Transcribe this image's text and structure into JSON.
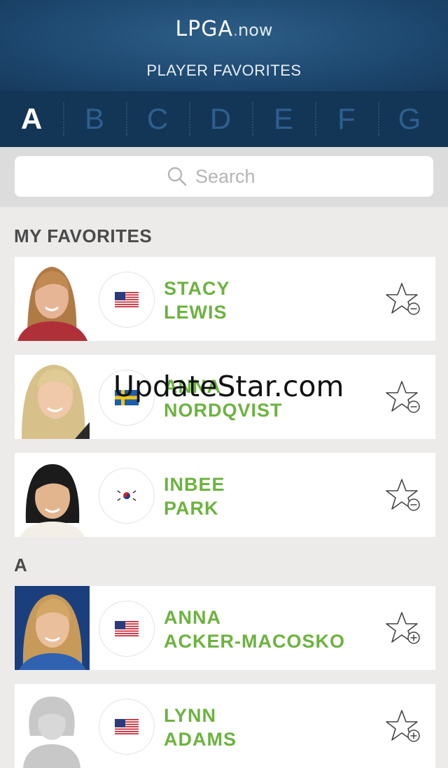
{
  "header": {
    "logo_main": "LPGA",
    "logo_dot": ".",
    "logo_sub": "now",
    "title": "PLAYER FAVORITES"
  },
  "alphabet": [
    "A",
    "B",
    "C",
    "D",
    "E",
    "F",
    "G"
  ],
  "alphabet_active": "A",
  "search": {
    "placeholder": "Search"
  },
  "sections": {
    "favorites_title": "MY FAVORITES",
    "a_title": "A"
  },
  "favorites": [
    {
      "first": "STACY",
      "last": "LEWIS",
      "flag": "usa",
      "action": "remove"
    },
    {
      "first": "ANNA",
      "last": "NORDQVIST",
      "flag": "sweden",
      "action": "remove"
    },
    {
      "first": "INBEE",
      "last": "PARK",
      "flag": "korea",
      "action": "remove"
    }
  ],
  "a_players": [
    {
      "first": "ANNA",
      "last": "ACKER-MACOSKO",
      "flag": "usa",
      "action": "add"
    },
    {
      "first": "LYNN",
      "last": "ADAMS",
      "flag": "usa",
      "action": "add"
    }
  ],
  "watermark": "UpdateStar.com",
  "colors": {
    "accent_green": "#6cb33f",
    "header_blue": "#1f4a72",
    "alpha_bar": "#133657"
  }
}
